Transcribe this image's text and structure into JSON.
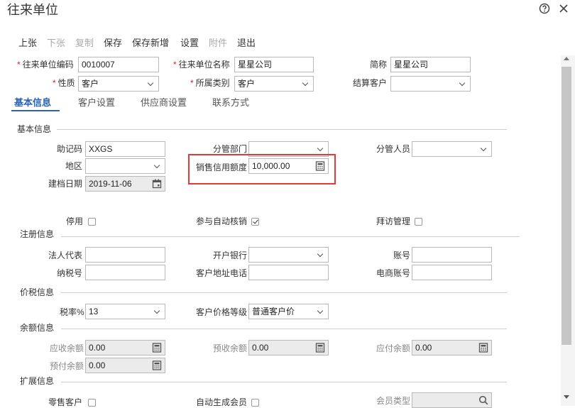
{
  "window": {
    "title": "往来单位"
  },
  "toolbar": [
    "上张",
    "下张",
    "复制",
    "保存",
    "保存新增",
    "设置",
    "附件",
    "退出"
  ],
  "header": {
    "code_label": "往来单位编码",
    "code_value": "0010007",
    "name_label": "往来单位名称",
    "name_value": "星星公司",
    "short_label": "简称",
    "short_value": "星星公司",
    "nature_label": "性质",
    "nature_value": "客户",
    "category_label": "所属类别",
    "category_value": "客户",
    "settle_label": "结算客户",
    "settle_value": ""
  },
  "tabs": [
    "基本信息",
    "客户设置",
    "供应商设置",
    "联系方式"
  ],
  "sections": {
    "basic": "基本信息",
    "register": "注册信息",
    "price_tax": "价税信息",
    "balance": "余额信息",
    "extend": "扩展信息"
  },
  "basic": {
    "mnemonic_label": "助记码",
    "mnemonic_value": "XXGS",
    "dept_label": "分管部门",
    "dept_value": "",
    "staff_label": "分管人员",
    "staff_value": "",
    "region_label": "地区",
    "region_value": "",
    "credit_label": "销售信用额度",
    "credit_value": "10,000.00",
    "created_label": "建档日期",
    "created_value": "2019-11-06",
    "disabled_label": "停用",
    "disabled_checked": false,
    "autoverify_label": "参与自动核销",
    "autoverify_checked": true,
    "visit_label": "拜访管理",
    "visit_checked": false
  },
  "register": {
    "legal_label": "法人代表",
    "legal_value": "",
    "bank_label": "开户银行",
    "bank_value": "",
    "account_label": "账号",
    "account_value": "",
    "taxno_label": "纳税号",
    "taxno_value": "",
    "addr_label": "客户地址电话",
    "addr_value": "",
    "ecom_label": "电商账号",
    "ecom_value": ""
  },
  "price_tax": {
    "rate_label": "税率%",
    "rate_value": "13",
    "level_label": "客户价格等级",
    "level_value": "普通客户价"
  },
  "balance": {
    "ar_label": "应收余额",
    "ar_value": "0.00",
    "prerecv_label": "预收余额",
    "prerecv_value": "0.00",
    "ap_label": "应付余额",
    "ap_value": "0.00",
    "prepay_label": "预付余额",
    "prepay_value": "0.00"
  },
  "extend": {
    "zero_label": "零售客户",
    "zero_checked": false,
    "member_label": "自动生成会员",
    "member_checked": false,
    "mtype_label": "会员类型",
    "mtype_value": ""
  },
  "icons": [
    "help-icon",
    "close-icon",
    "calculator-icon",
    "calendar-icon",
    "search-icon"
  ],
  "colors": {
    "accent": "#2a62b4",
    "required": "#e02020",
    "highlight": "#e23a3a"
  }
}
